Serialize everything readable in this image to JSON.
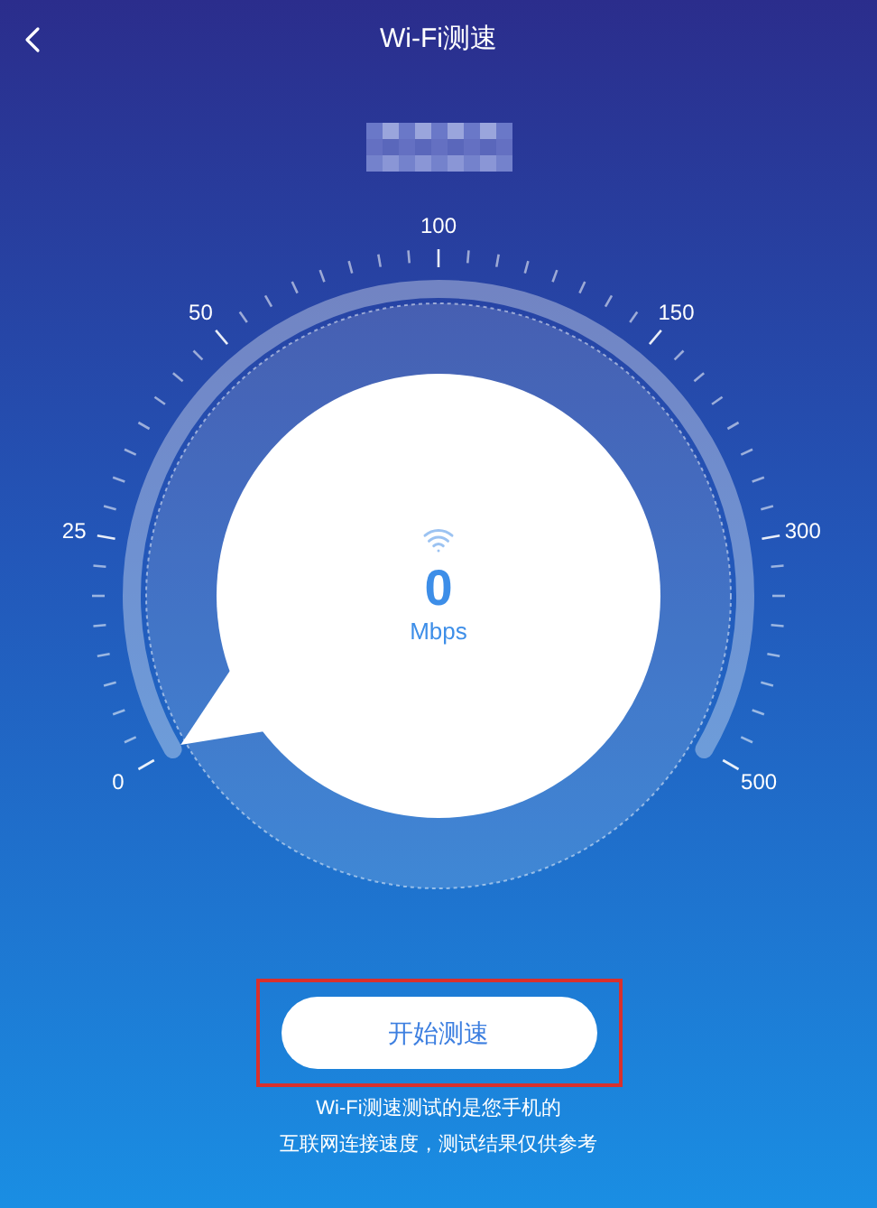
{
  "header": {
    "title": "Wi-Fi测速"
  },
  "gauge": {
    "labels": [
      "0",
      "25",
      "50",
      "100",
      "150",
      "300",
      "500"
    ],
    "speed": "0",
    "unit": "Mbps"
  },
  "start_button": {
    "label": "开始测速"
  },
  "caption": [
    "Wi-Fi测速测试的是您手机的",
    "互联网连接速度，测试结果仅供参考"
  ]
}
